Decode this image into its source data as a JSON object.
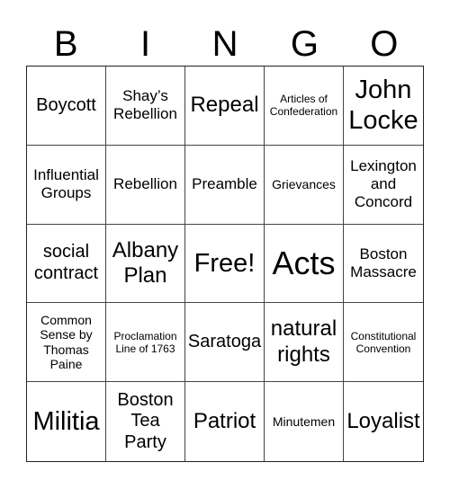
{
  "header": {
    "letters": [
      "B",
      "I",
      "N",
      "G",
      "O"
    ]
  },
  "cells": [
    "Boycott",
    "Shay’s Rebellion",
    "Repeal",
    "Articles of Confederation",
    "John Locke",
    "Influential Groups",
    "Rebellion",
    "Preamble",
    "Grievances",
    "Lexington and Concord",
    "social contract",
    "Albany Plan",
    "Free!",
    "Acts",
    "Boston Massacre",
    "Common Sense by Thomas Paine",
    "Proclamation Line of 1763",
    "Saratoga",
    "natural rights",
    "Constitutional Convention",
    "Militia",
    "Boston Tea Party",
    "Patriot",
    "Minutemen",
    "Loyalist"
  ]
}
